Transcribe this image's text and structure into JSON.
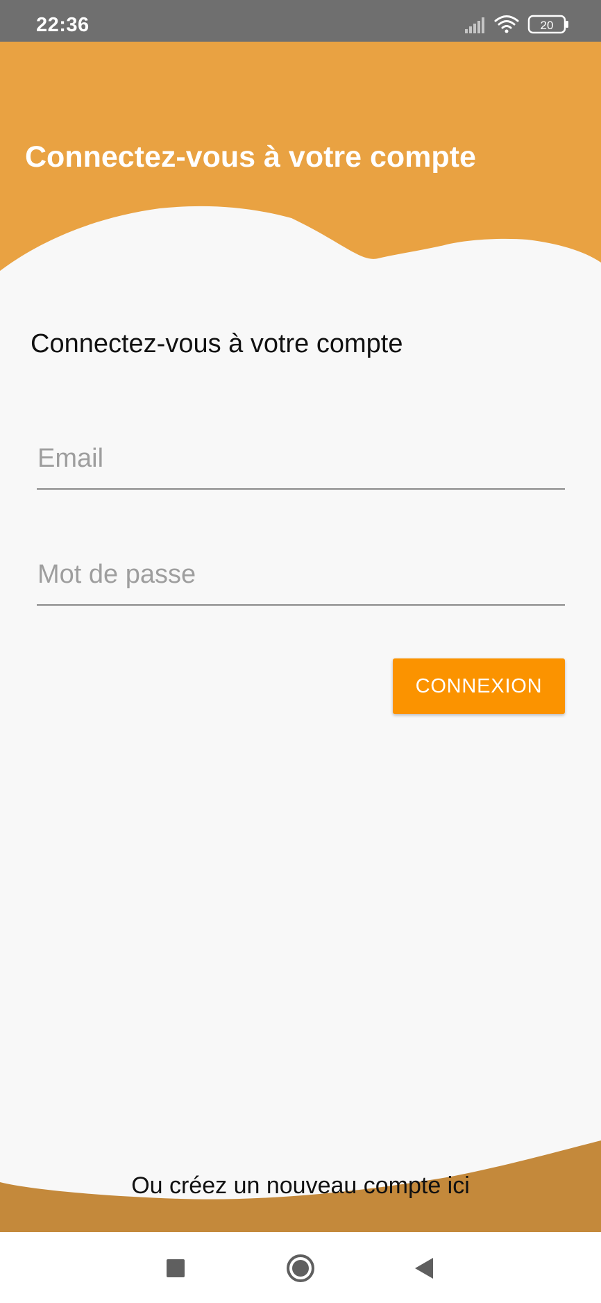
{
  "status_bar": {
    "time": "22:36",
    "battery": "20",
    "icons": [
      "signal-icon",
      "wifi-icon",
      "battery-icon"
    ]
  },
  "header": {
    "title": "Connectez-vous à votre compte"
  },
  "login": {
    "heading": "Connectez-vous à votre compte",
    "email_placeholder": "Email",
    "password_placeholder": "Mot de passe",
    "submit_label": "CONNEXION"
  },
  "footer": {
    "create_account_text": "Ou créez un nouveau compte ici"
  },
  "nav_bar": {
    "icons": [
      "recents-icon",
      "home-icon",
      "back-icon"
    ]
  },
  "colors": {
    "status_bar": "#6f6f6f",
    "header": "#e9a242",
    "button": "#fb9300",
    "footer": "#c4893b",
    "background": "#f8f8f8"
  }
}
